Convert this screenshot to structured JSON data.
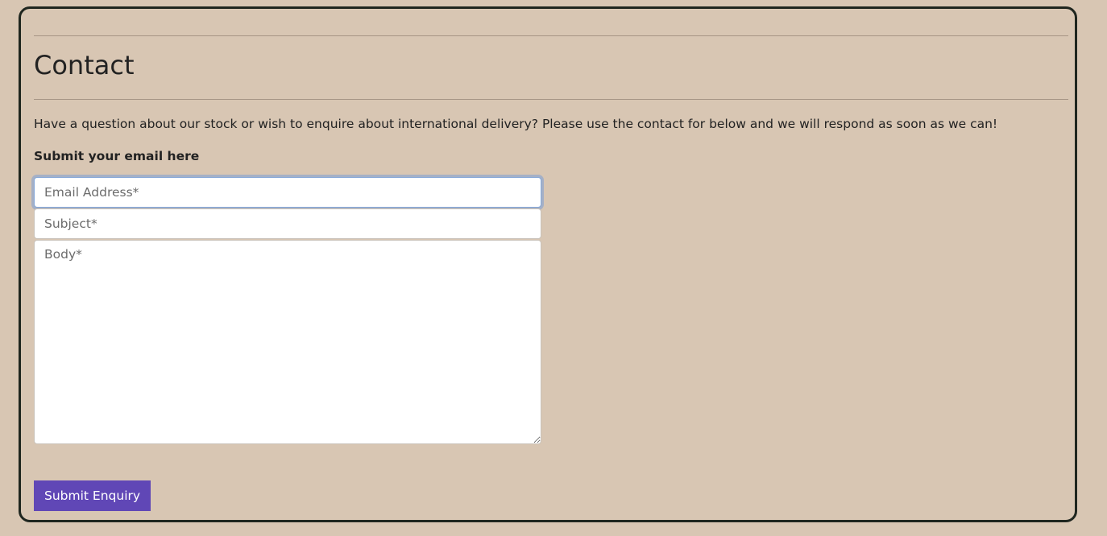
{
  "page": {
    "title": "Contact",
    "intro": "Have a question about our stock or wish to enquire about international delivery? Please use the contact for below and we will respond as soon as we can!",
    "form_heading": "Submit your email here"
  },
  "form": {
    "email": {
      "placeholder": "Email Address*",
      "value": ""
    },
    "subject": {
      "placeholder": "Subject*",
      "value": ""
    },
    "body": {
      "placeholder": "Body*",
      "value": ""
    },
    "submit_label": "Submit Enquiry"
  },
  "colors": {
    "background": "#d8c6b3",
    "card_border": "#1f261f",
    "button": "#6047b6",
    "focus_ring": "#86a8d8"
  }
}
